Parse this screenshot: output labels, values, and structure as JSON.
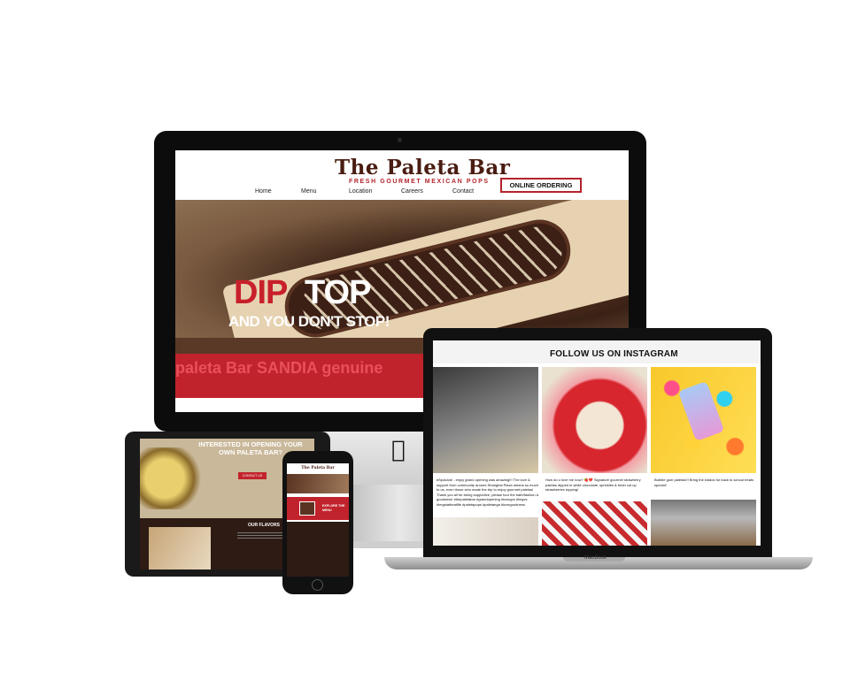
{
  "imac": {
    "brand": {
      "title": "The Paleta Bar",
      "subtitle": "FRESH GOURMET MEXICAN POPS"
    },
    "nav": [
      "Home",
      "Menu",
      "Location",
      "Careers",
      "Contact"
    ],
    "order_button": "ONLINE ORDERING",
    "hero": {
      "dip": "DIP",
      "top": "TOP",
      "tagline": "AND YOU DON'T STOP!"
    },
    "banner_text": "paleta Bar  SANDIA  genuine"
  },
  "macbook": {
    "label": "MacBook",
    "instagram_title": "FOLLOW US ON INSTAGRAM",
    "captions": [
      "#Spokane - enjoy grand opening was amazing!!! The love & support from community around Shanghai Plaza means so much to us, even those who made the trip to enjoy gourmet paletas! Thank you all for being supportive, please tour the bath/fashion & goodness! #thepaletabar #grandopening #lovegvs #lmgvs #lmgstatbeatlife #paletapops #paletanga #lovegoodness",
      "How do u love me now? 🍓❤️ Signature gourmet strawberry paletas dipped in white chocolate, sprinkles & fresh cut up strawberries topping!",
      "Bubble gum paletas!!! Bring the kiddos for back to school treats special!"
    ]
  },
  "tablet": {
    "headline": "INTERESTED IN OPENING YOUR OWN PALETA BAR?",
    "button": "CONTACT US",
    "section": "OUR FLAVORS"
  },
  "phone": {
    "brand": "The Paleta Bar",
    "explore": "EXPLORE THE MENU"
  },
  "colors": {
    "brand_red": "#c1232c",
    "brand_brown": "#4a1d12"
  }
}
